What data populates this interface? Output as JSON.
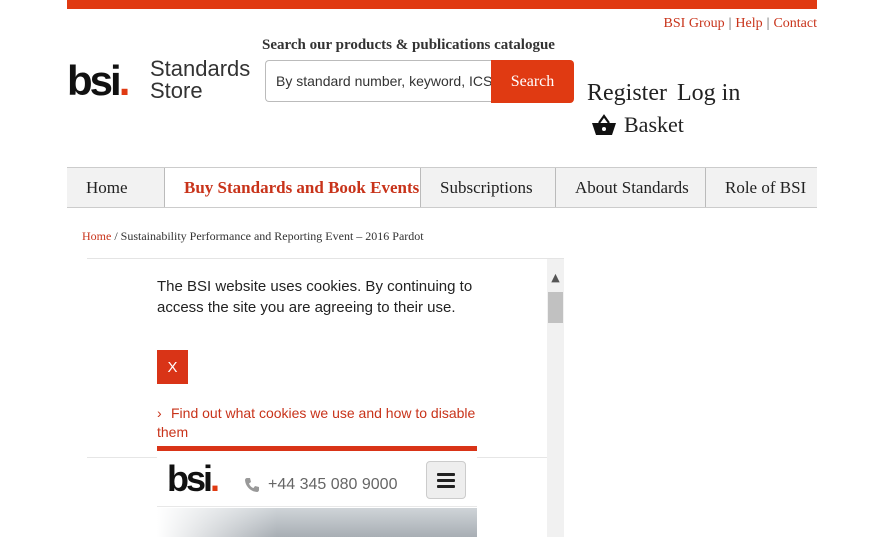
{
  "colors": {
    "brand_red": "#e03a12",
    "nav_bg": "#f2f2f2",
    "link_red": "#c8331a"
  },
  "top_links": [
    "BSI Group",
    "Help",
    "Contact"
  ],
  "logo": {
    "mark": "bsi",
    "product_line1": "Standards",
    "product_line2": "Store"
  },
  "search": {
    "label": "Search our products & publications catalogue",
    "placeholder": "By standard number, keyword, ICS",
    "button": "Search",
    "icon": "search-icon"
  },
  "account": {
    "register": "Register",
    "login": "Log in",
    "basket": "Basket",
    "basket_icon": "basket-icon"
  },
  "nav": [
    {
      "label": "Home",
      "active": false
    },
    {
      "label": "Buy Standards and Book Events",
      "active": true
    },
    {
      "label": "Subscriptions",
      "active": false
    },
    {
      "label": "About Standards",
      "active": false
    },
    {
      "label": "Role of BSI",
      "active": false
    }
  ],
  "breadcrumb": {
    "home": "Home",
    "separator": "/",
    "current": "Sustainability Performance and Reporting Event – 2016 Pardot"
  },
  "cookie": {
    "message": "The BSI website uses cookies. By continuing to access the site you are agreeing to their use.",
    "close": "X",
    "link": "Find out what cookies we use and how to disable them"
  },
  "embedded_site": {
    "logo": "bsi",
    "phone": "+44 345 080 9000",
    "menu_icon": "hamburger-icon"
  }
}
